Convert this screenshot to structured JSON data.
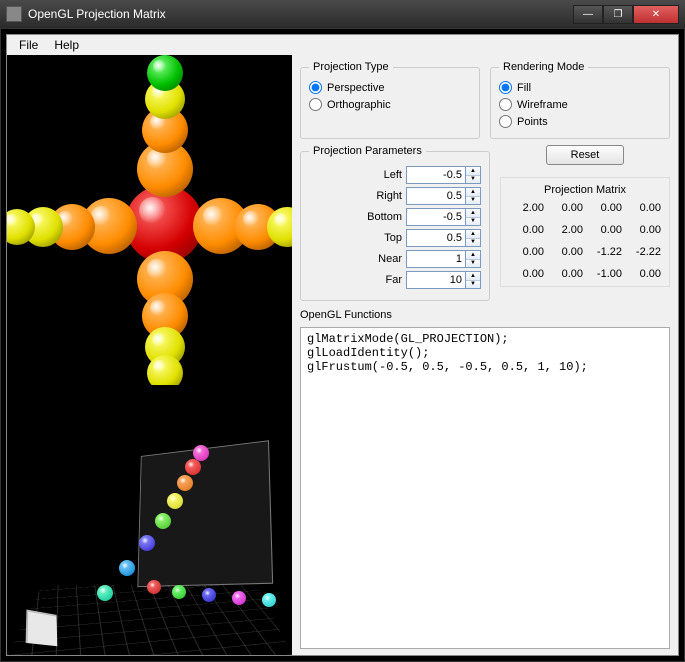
{
  "window": {
    "title": "OpenGL Projection Matrix",
    "buttons": {
      "minimize": "—",
      "maximize": "❐",
      "close": "✕"
    }
  },
  "menu": {
    "file": "File",
    "help": "Help"
  },
  "groups": {
    "projection_type": {
      "legend": "Projection Type",
      "perspective": "Perspective",
      "orthographic": "Orthographic",
      "selected": "perspective"
    },
    "rendering_mode": {
      "legend": "Rendering Mode",
      "fill": "Fill",
      "wireframe": "Wireframe",
      "points": "Points",
      "selected": "fill"
    }
  },
  "params": {
    "legend": "Projection Parameters",
    "left": {
      "label": "Left",
      "value": "-0.5"
    },
    "right": {
      "label": "Right",
      "value": "0.5"
    },
    "bottom": {
      "label": "Bottom",
      "value": "-0.5"
    },
    "top": {
      "label": "Top",
      "value": "0.5"
    },
    "near": {
      "label": "Near",
      "value": "1"
    },
    "far": {
      "label": "Far",
      "value": "10"
    }
  },
  "reset_label": "Reset",
  "matrix": {
    "title": "Projection Matrix",
    "cells": [
      "2.00",
      "0.00",
      "0.00",
      "0.00",
      "0.00",
      "2.00",
      "0.00",
      "0.00",
      "0.00",
      "0.00",
      "-1.22",
      "-2.22",
      "0.00",
      "0.00",
      "-1.00",
      "0.00"
    ]
  },
  "functions": {
    "label": "OpenGL Functions",
    "text": "glMatrixMode(GL_PROJECTION);\nglLoadIdentity();\nglFrustum(-0.5, 0.5, -0.5, 0.5, 1, 10);"
  }
}
